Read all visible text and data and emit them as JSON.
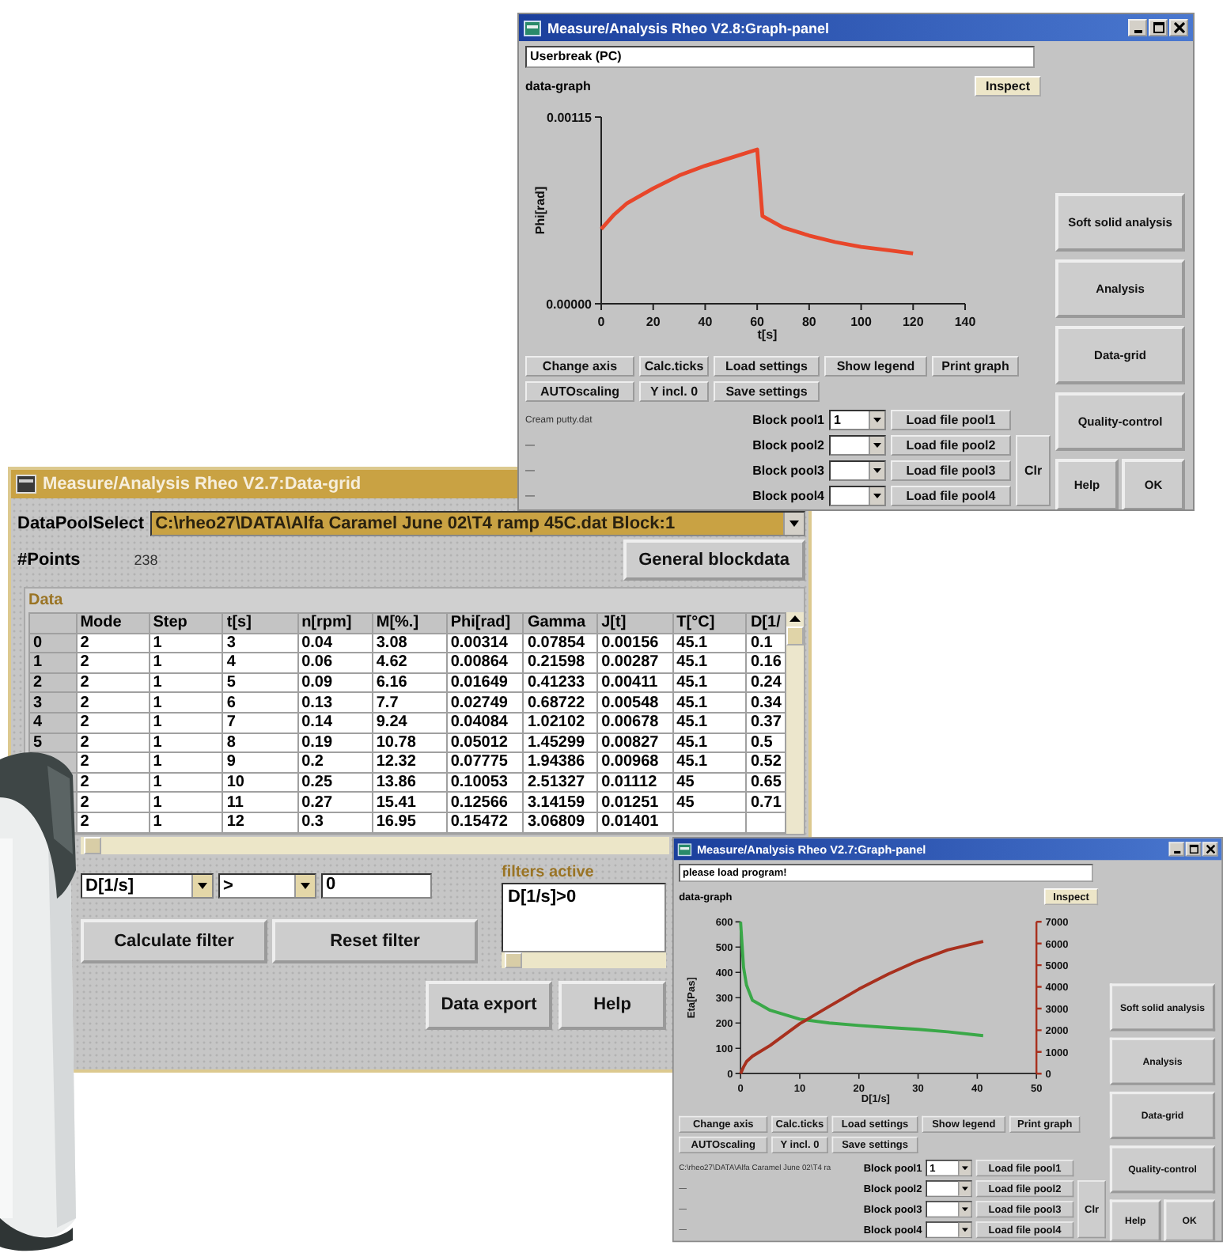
{
  "graph_panel_top": {
    "title": "Measure/Analysis Rheo V2.8:Graph-panel",
    "status": "Userbreak (PC)",
    "graph_label": "data-graph",
    "inspect": "Inspect",
    "chart_data": {
      "type": "line",
      "xlabel": "t[s]",
      "ylabel": "Phi[rad]",
      "x": [
        0,
        5,
        10,
        20,
        30,
        40,
        50,
        60,
        61,
        62,
        70,
        80,
        90,
        100,
        110,
        120
      ],
      "series": [
        {
          "color": "#e8462a",
          "values": [
            0.00046,
            0.00055,
            0.00062,
            0.00071,
            0.00079,
            0.00085,
            0.0009,
            0.00095,
            0.00075,
            0.00054,
            0.00047,
            0.00042,
            0.00038,
            0.00035,
            0.00033,
            0.00031
          ]
        }
      ],
      "xlim": [
        0,
        140
      ],
      "ylim": [
        0,
        0.00115
      ],
      "xticks": [
        0,
        20,
        40,
        60,
        80,
        100,
        120,
        140
      ],
      "yticks": [
        {
          "value": 0,
          "label": "0.00000"
        },
        {
          "value": 0.00115,
          "label": "0.00115"
        }
      ]
    },
    "tool_rows": [
      {
        "buttons": [
          "Change axis",
          "Calc.ticks",
          "Load settings",
          "Show legend",
          "Print graph"
        ]
      },
      {
        "buttons": [
          "AUTOscaling",
          "Y incl. 0",
          "Save settings"
        ]
      }
    ],
    "pools": [
      {
        "file": "Cream putty.dat",
        "label": "Block pool1",
        "value": "1",
        "load": "Load file pool1"
      },
      {
        "file": "—",
        "label": "Block pool2",
        "load": "Load file pool2"
      },
      {
        "file": "—",
        "label": "Block pool3",
        "load": "Load file pool3"
      },
      {
        "file": "—",
        "label": "Block pool4",
        "load": "Load file pool4"
      }
    ],
    "clear": "Clr",
    "side_buttons": [
      "Soft solid analysis",
      "Analysis",
      "Data-grid",
      "Quality-control"
    ],
    "bottom_buttons": [
      "Help",
      "OK"
    ]
  },
  "data_grid_window": {
    "title": "Measure/Analysis Rheo V2.7:Data-grid",
    "pool_select": {
      "label": "DataPoolSelect",
      "value": "C:\\rheo27\\DATA\\Alfa Caramel June 02\\T4 ramp 45C.dat Block:1"
    },
    "points": {
      "label": "#Points",
      "value": "238"
    },
    "general_button": "General blockdata",
    "group_label": "Data",
    "table": {
      "columns": [
        "Mode",
        "Step",
        "t[s]",
        "n[rpm]",
        "M[%.]",
        "Phi[rad]",
        "Gamma",
        "J[t]",
        "T[°C]",
        "D[1/"
      ],
      "rows": [
        {
          "index": "0",
          "cells": [
            "2",
            "1",
            "3",
            "0.04",
            "3.08",
            "0.00314",
            "0.07854",
            "0.00156",
            "45.1",
            "0.1"
          ]
        },
        {
          "index": "1",
          "cells": [
            "2",
            "1",
            "4",
            "0.06",
            "4.62",
            "0.00864",
            "0.21598",
            "0.00287",
            "45.1",
            "0.16"
          ]
        },
        {
          "index": "2",
          "cells": [
            "2",
            "1",
            "5",
            "0.09",
            "6.16",
            "0.01649",
            "0.41233",
            "0.00411",
            "45.1",
            "0.24"
          ]
        },
        {
          "index": "3",
          "cells": [
            "2",
            "1",
            "6",
            "0.13",
            "7.7",
            "0.02749",
            "0.68722",
            "0.00548",
            "45.1",
            "0.34"
          ]
        },
        {
          "index": "4",
          "cells": [
            "2",
            "1",
            "7",
            "0.14",
            "9.24",
            "0.04084",
            "1.02102",
            "0.00678",
            "45.1",
            "0.37"
          ]
        },
        {
          "index": "5",
          "cells": [
            "2",
            "1",
            "8",
            "0.19",
            "10.78",
            "0.05012",
            "1.45299",
            "0.00827",
            "45.1",
            "0.5"
          ]
        },
        {
          "cells": [
            "2",
            "1",
            "9",
            "0.2",
            "12.32",
            "0.07775",
            "1.94386",
            "0.00968",
            "45.1",
            "0.52"
          ]
        },
        {
          "cells": [
            "2",
            "1",
            "10",
            "0.25",
            "13.86",
            "0.10053",
            "2.51327",
            "0.01112",
            "45",
            "0.65"
          ]
        },
        {
          "cells": [
            "2",
            "1",
            "11",
            "0.27",
            "15.41",
            "0.12566",
            "3.14159",
            "0.01251",
            "45",
            "0.71"
          ]
        },
        {
          "cells": [
            "2",
            "1",
            "12",
            "0.3",
            "16.95",
            "0.15472",
            "3.06809",
            "0.01401"
          ]
        }
      ]
    },
    "filter": {
      "column": "D[1/s]",
      "operator": ">",
      "value": "0"
    },
    "filter_buttons": [
      "Calculate filter",
      "Reset filter"
    ],
    "active_label": "filters active",
    "active_filters": [
      "D[1/s]>0"
    ],
    "bottom_buttons": [
      "Data export",
      "Help"
    ]
  },
  "graph_panel_bottom": {
    "title": "Measure/Analysis Rheo V2.7:Graph-panel",
    "status": "please load program!",
    "graph_label": "data-graph",
    "inspect": "Inspect",
    "chart_data": {
      "type": "line",
      "xlabel": "D[1/s]",
      "ylabel": "Eta[Pas]",
      "x": [
        0,
        0.5,
        1,
        2,
        5,
        10,
        15,
        20,
        25,
        30,
        35,
        41
      ],
      "series": [
        {
          "color": "#3aa848",
          "values": [
            600,
            420,
            350,
            290,
            250,
            215,
            200,
            190,
            182,
            175,
            165,
            150
          ]
        },
        {
          "color": "#a8301e",
          "axis": "y2",
          "values": [
            0,
            300,
            550,
            800,
            1300,
            2300,
            3100,
            3900,
            4600,
            5200,
            5700,
            6100
          ]
        }
      ],
      "xlim": [
        0,
        50
      ],
      "ylim": [
        0,
        600
      ],
      "y2lim": [
        0,
        7000
      ],
      "xticks": [
        0,
        10,
        20,
        30,
        40,
        50
      ],
      "yticks": [
        0,
        100,
        200,
        300,
        400,
        500,
        600
      ],
      "y2ticks": [
        0,
        1000,
        2000,
        3000,
        4000,
        5000,
        6000,
        7000
      ]
    },
    "tool_rows": [
      {
        "buttons": [
          "Change axis",
          "Calc.ticks",
          "Load settings",
          "Show legend",
          "Print graph"
        ]
      },
      {
        "buttons": [
          "AUTOscaling",
          "Y incl. 0",
          "Save settings"
        ]
      }
    ],
    "pools": [
      {
        "file": "C:\\rheo27\\DATA\\Alfa Caramel June 02\\T4 ra",
        "label": "Block pool1",
        "value": "1",
        "load": "Load file pool1"
      },
      {
        "file": "—",
        "label": "Block pool2",
        "load": "Load file pool2"
      },
      {
        "file": "—",
        "label": "Block pool3",
        "load": "Load file pool3"
      },
      {
        "file": "—",
        "label": "Block pool4",
        "load": "Load file pool4"
      }
    ],
    "clear": "Clr",
    "side_buttons": [
      "Soft solid analysis",
      "Analysis",
      "Data-grid",
      "Quality-control"
    ],
    "bottom_buttons": [
      "Help",
      "OK"
    ]
  }
}
